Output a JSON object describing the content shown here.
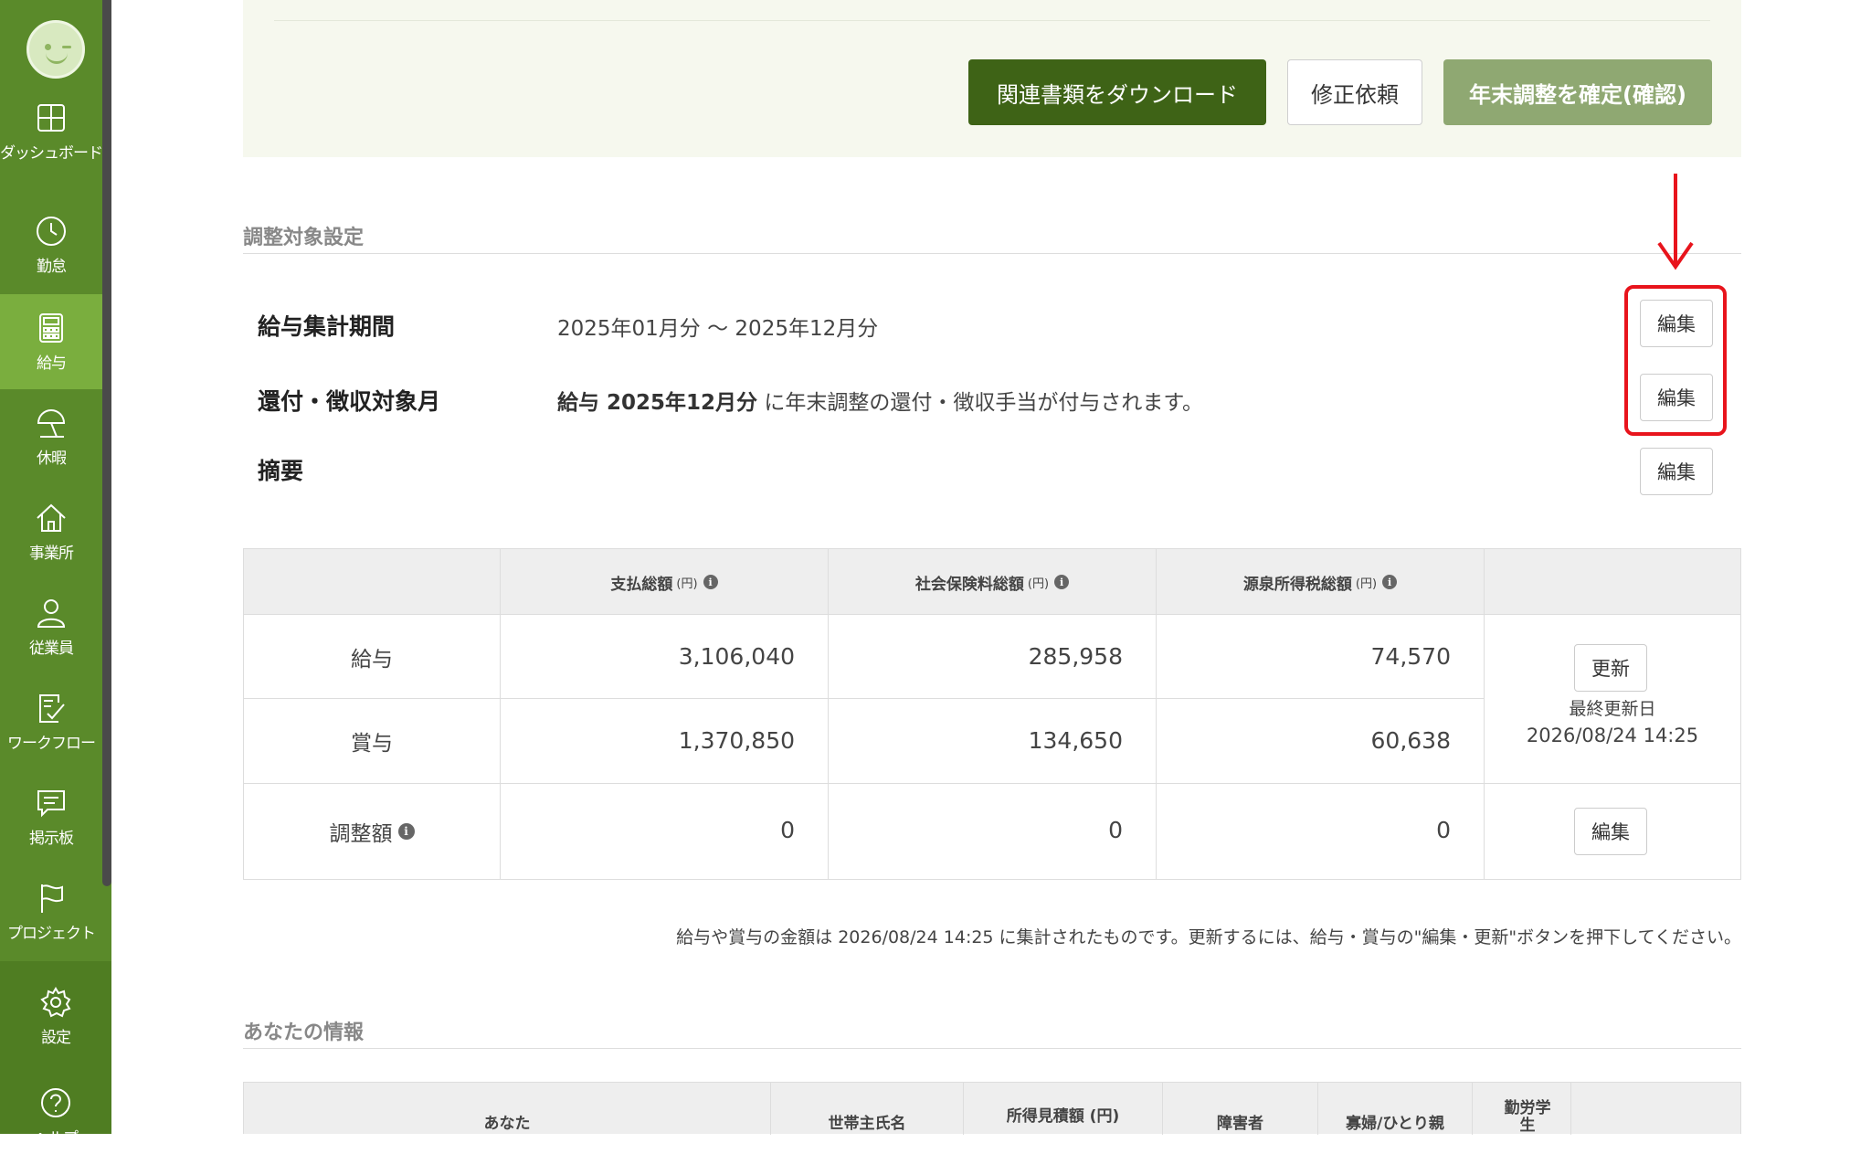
{
  "sidebar": {
    "items": [
      {
        "label": "ダッシュボード",
        "icon": "dashboard-icon"
      },
      {
        "label": "勤怠",
        "icon": "clock-icon"
      },
      {
        "label": "給与",
        "icon": "calculator-icon",
        "active": true
      },
      {
        "label": "休暇",
        "icon": "beach-umbrella-icon"
      },
      {
        "label": "事業所",
        "icon": "home-icon"
      },
      {
        "label": "従業員",
        "icon": "person-icon"
      },
      {
        "label": "ワークフロー",
        "icon": "checklist-icon"
      },
      {
        "label": "掲示板",
        "icon": "chat-icon"
      },
      {
        "label": "プロジェクト",
        "icon": "flag-icon"
      }
    ],
    "settings_label": "設定",
    "help_label": "ヘルプ"
  },
  "actions": {
    "download": "関連書類をダウンロード",
    "request_fix": "修正依頼",
    "confirm": "年末調整を確定(確認)"
  },
  "adjustment": {
    "title": "調整対象設定",
    "rows": [
      {
        "label": "給与集計期間",
        "value": "2025年01月分 〜 2025年12月分",
        "edit": "編集"
      },
      {
        "label": "還付・徴収対象月",
        "value_bold": "給与 2025年12月分",
        "value_rest": "に年末調整の還付・徴収手当が付与されます。",
        "edit": "編集"
      },
      {
        "label": "摘要",
        "value": "",
        "edit": "編集"
      }
    ]
  },
  "totals": {
    "headers": [
      {
        "label": "支払総額",
        "unit": "(円)"
      },
      {
        "label": "社会保険料総額",
        "unit": "(円)"
      },
      {
        "label": "源泉所得税総額",
        "unit": "(円)"
      }
    ],
    "rows": [
      {
        "label": "給与",
        "values": [
          "3,106,040",
          "285,958",
          "74,570"
        ]
      },
      {
        "label": "賞与",
        "values": [
          "1,370,850",
          "134,650",
          "60,638"
        ]
      },
      {
        "label": "調整額",
        "values": [
          "0",
          "0",
          "0"
        ]
      }
    ],
    "update_button": "更新",
    "last_updated_label": "最終更新日",
    "last_updated_value": "2026/08/24 14:25",
    "edit_button": "編集",
    "note": "給与や賞与の金額は 2026/08/24 14:25 に集計されたものです。更新するには、給与・賞与の\"編集・更新\"ボタンを押下してください。"
  },
  "you": {
    "title": "あなたの情報",
    "headers": [
      "あなた",
      "世帯主氏名",
      "所得見積額 (円)",
      "障害者",
      "寡婦/ひとり親",
      "勤労学生"
    ]
  },
  "colors": {
    "sidebar": "#5a8a2a",
    "sidebar_active": "#7aae3e",
    "primary_button": "#3e6316",
    "highlight": "#e8141c"
  }
}
